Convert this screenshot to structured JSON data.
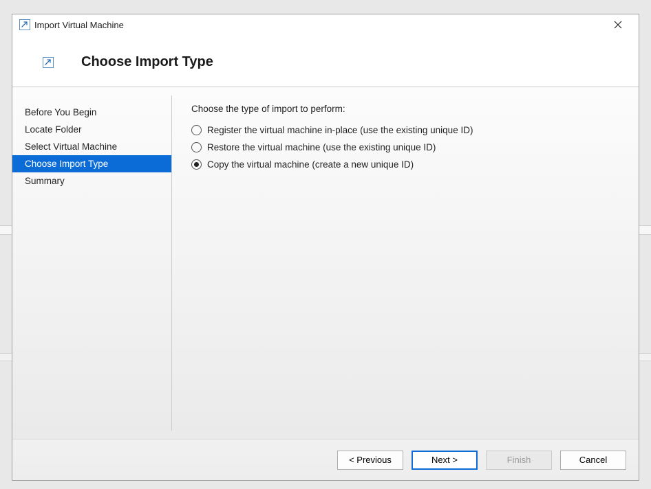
{
  "window": {
    "title": "Import Virtual Machine"
  },
  "header": {
    "title": "Choose Import Type"
  },
  "sidebar": {
    "steps": [
      "Before You Begin",
      "Locate Folder",
      "Select Virtual Machine",
      "Choose Import Type",
      "Summary"
    ],
    "activeIndex": 3
  },
  "content": {
    "prompt": "Choose the type of import to perform:",
    "options": [
      "Register the virtual machine in-place (use the existing unique ID)",
      "Restore the virtual machine (use the existing unique ID)",
      "Copy the virtual machine (create a new unique ID)"
    ],
    "selectedIndex": 2
  },
  "footer": {
    "previous": "< Previous",
    "next": "Next >",
    "finish": "Finish",
    "cancel": "Cancel"
  },
  "icons": {
    "arrow": "arrow-icon"
  }
}
